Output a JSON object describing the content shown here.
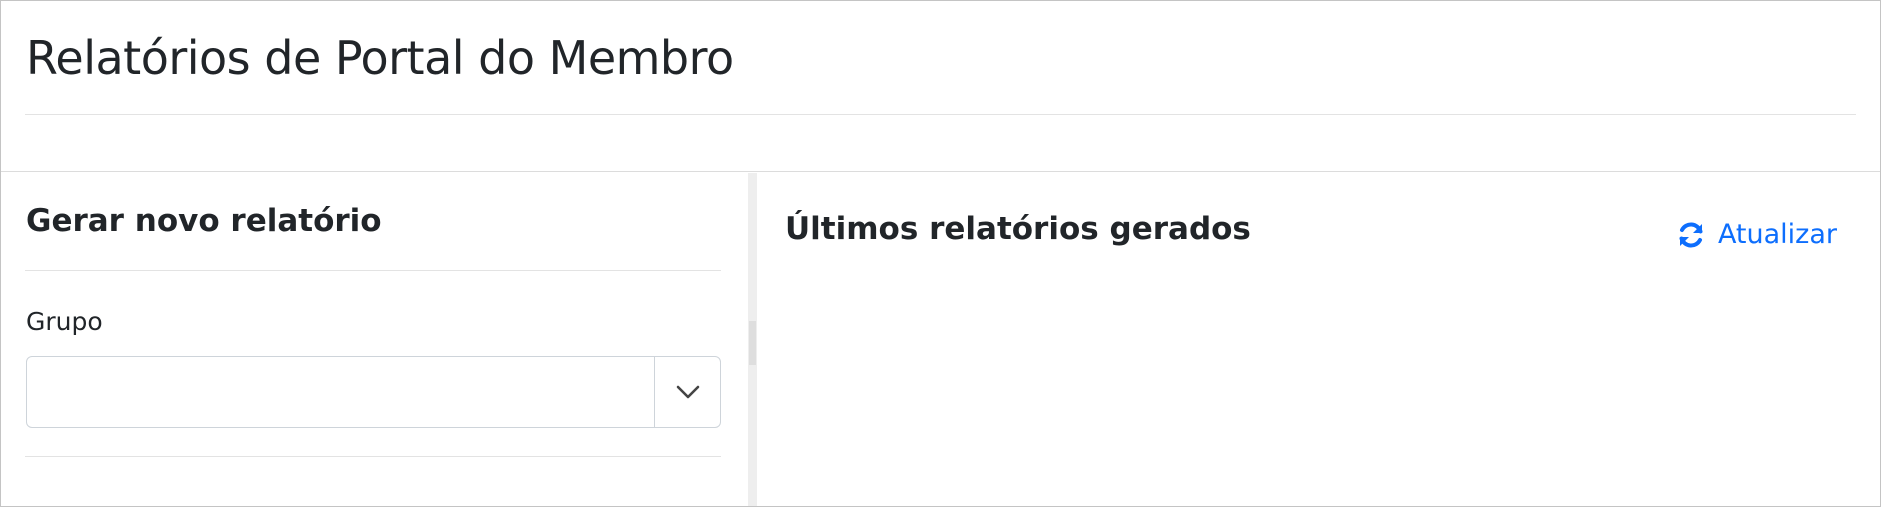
{
  "page": {
    "title": "Relatórios de Portal do Membro"
  },
  "generate_panel": {
    "title": "Gerar novo relatório",
    "group_label": "Grupo",
    "group_value": "",
    "chevron_icon": "chevron-down-icon"
  },
  "reports_panel": {
    "title": "Últimos relatórios gerados",
    "refresh_label": "Atualizar",
    "refresh_icon": "sync-icon"
  },
  "colors": {
    "link": "#0d6efd",
    "text": "#212529",
    "border": "#ced4da"
  }
}
